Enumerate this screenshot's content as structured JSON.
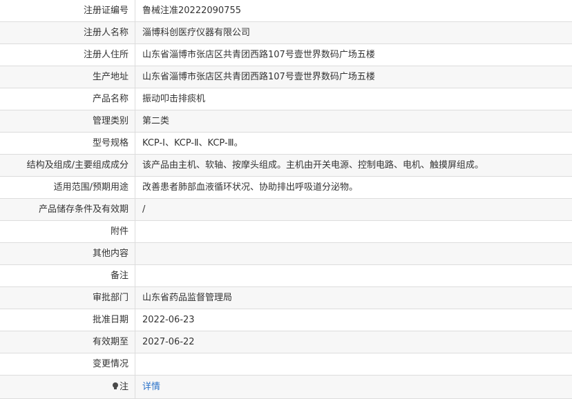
{
  "rows": [
    {
      "label": "注册证编号",
      "value": "鲁械注准20222090755"
    },
    {
      "label": "注册人名称",
      "value": "淄博科创医疗仪器有限公司"
    },
    {
      "label": "注册人住所",
      "value": "山东省淄博市张店区共青团西路107号壹世界数码广场五楼"
    },
    {
      "label": "生产地址",
      "value": "山东省淄博市张店区共青团西路107号壹世界数码广场五楼"
    },
    {
      "label": "产品名称",
      "value": "振动叩击排痰机"
    },
    {
      "label": "管理类别",
      "value": "第二类"
    },
    {
      "label": "型号规格",
      "value": "KCP-Ⅰ、KCP-Ⅱ、KCP-Ⅲ。"
    },
    {
      "label": "结构及组成/主要组成成分",
      "value": "该产品由主机、软轴、按摩头组成。主机由开关电源、控制电路、电机、触摸屏组成。"
    },
    {
      "label": "适用范围/预期用途",
      "value": "改善患者肺部血液循环状况、协助排出呼吸道分泌物。"
    },
    {
      "label": "产品储存条件及有效期",
      "value": "/"
    },
    {
      "label": "附件",
      "value": ""
    },
    {
      "label": "其他内容",
      "value": ""
    },
    {
      "label": "备注",
      "value": ""
    },
    {
      "label": "审批部门",
      "value": "山东省药品监督管理局"
    },
    {
      "label": "批准日期",
      "value": "2022-06-23"
    },
    {
      "label": "有效期至",
      "value": "2027-06-22"
    },
    {
      "label": "变更情况",
      "value": ""
    }
  ],
  "note_row": {
    "label": "注",
    "icon": "lightbulb-icon",
    "link_text": "详情",
    "link_color": "#2a72c9"
  }
}
